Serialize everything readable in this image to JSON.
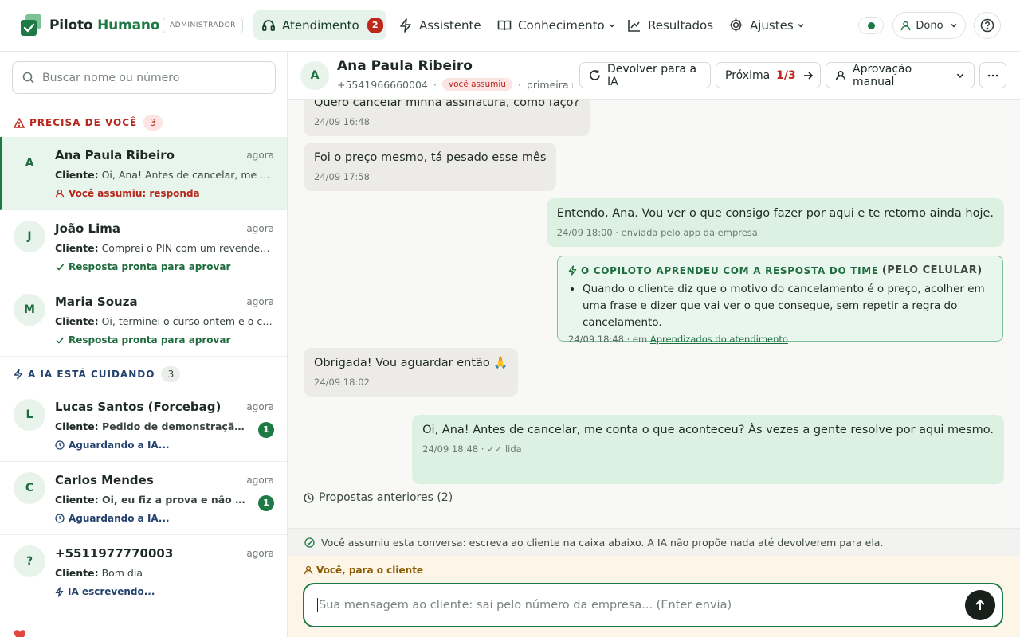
{
  "app": {
    "brand_part1": "Piloto",
    "brand_part2": "Humano",
    "role_badge": "ADMINISTRADOR"
  },
  "nav": {
    "atendimento": {
      "label": "Atendimento",
      "badge": "2"
    },
    "assistente": {
      "label": "Assistente"
    },
    "conhecimento": {
      "label": "Conhecimento"
    },
    "resultados": {
      "label": "Resultados"
    },
    "ajustes": {
      "label": "Ajustes"
    }
  },
  "user": {
    "label": "Dono"
  },
  "search": {
    "placeholder": "Buscar nome ou número"
  },
  "sections": {
    "needs_you": {
      "label": "PRECISA DE VOCÊ",
      "count": "3"
    },
    "ai_handling": {
      "label": "A IA ESTÁ CUIDANDO",
      "count": "3"
    }
  },
  "conversations": [
    {
      "initial": "A",
      "name": "Ana Paula Ribeiro",
      "time": "agora",
      "prefix": "Cliente:",
      "preview": "Oi, Ana! Antes de cancelar, me conta o que aconteceu?",
      "status": "Você assumiu: responda"
    },
    {
      "initial": "J",
      "name": "João Lima",
      "time": "agora",
      "prefix": "Cliente:",
      "preview": "Comprei o PIN com um revendedor e não funciona",
      "status": "Resposta pronta para aprovar"
    },
    {
      "initial": "M",
      "name": "Maria Souza",
      "time": "agora",
      "prefix": "Cliente:",
      "preview": "Oi, terminei o curso ontem e o certificado não chegou",
      "status": "Resposta pronta para aprovar"
    },
    {
      "initial": "L",
      "name": "Lucas Santos (Forcebag)",
      "time": "agora",
      "prefix": "Cliente:",
      "preview": "Pedido de demonstração pelo site",
      "status": "Aguardando a IA...",
      "unread": "1"
    },
    {
      "initial": "C",
      "name": "Carlos Mendes",
      "time": "agora",
      "prefix": "Cliente:",
      "preview": "Oi, eu fiz a prova e não consigo ver a nota",
      "status": "Aguardando a IA...",
      "unread": "1"
    },
    {
      "initial": "?",
      "name": "+5511977770003",
      "time": "agora",
      "prefix": "Cliente:",
      "preview": "Bom dia",
      "status": "IA escrevendo..."
    }
  ],
  "chat": {
    "initial": "A",
    "name": "Ana Paula Ribeiro",
    "phone": "+5541966660004",
    "tag": "você assumiu",
    "extra": "primeira mensagem",
    "buttons": {
      "return_ai": "Devolver para a IA",
      "next": "Próxima",
      "next_count": "1/3",
      "approval": "Aprovação manual"
    }
  },
  "messages": [
    {
      "text": "Quero cancelar minha assinatura, como faço?",
      "meta": "24/09 16:48"
    },
    {
      "text": "Foi o preço mesmo, tá pesado esse mês",
      "meta": "24/09 17:58"
    },
    {
      "text": "Entendo, Ana. Vou ver o que consigo fazer por aqui e te retorno ainda hoje.",
      "meta": "24/09 18:00 · enviada pelo app da empresa"
    },
    {
      "text": "Obrigada! Vou aguardar então 🙏",
      "meta": "24/09 18:02"
    },
    {
      "text": "Oi, Ana! Antes de cancelar, me conta o que aconteceu? Às vezes a gente resolve por aqui mesmo.",
      "meta": "24/09 18:48 · ✓✓ lida"
    }
  ],
  "learning": {
    "title": "O COPILOTO APRENDEU COM A RESPOSTA DO TIME",
    "subtitle": "(PELO CELULAR)",
    "item": "Quando o cliente diz que o motivo do cancelamento é o preço, acolher em uma frase e dizer que vai ver o que consegue, sem repetir a regra do cancelamento.",
    "meta": "24/09 18:48 · em",
    "link": "Aprendizados do atendimento"
  },
  "previous_proposals": "Propostas anteriores (2)",
  "notice": "Você assumiu esta conversa: escreva ao cliente na caixa abaixo. A IA não propõe nada até devolverem para ela.",
  "composer": {
    "label": "Você, para o cliente",
    "placeholder": "Sua mensagem ao cliente: sai pelo número da empresa... (Enter envia)"
  },
  "colors": {
    "brand_green": "#1e7a45",
    "alert_red": "#c0271c",
    "composer_bg": "#fdf6e8"
  }
}
